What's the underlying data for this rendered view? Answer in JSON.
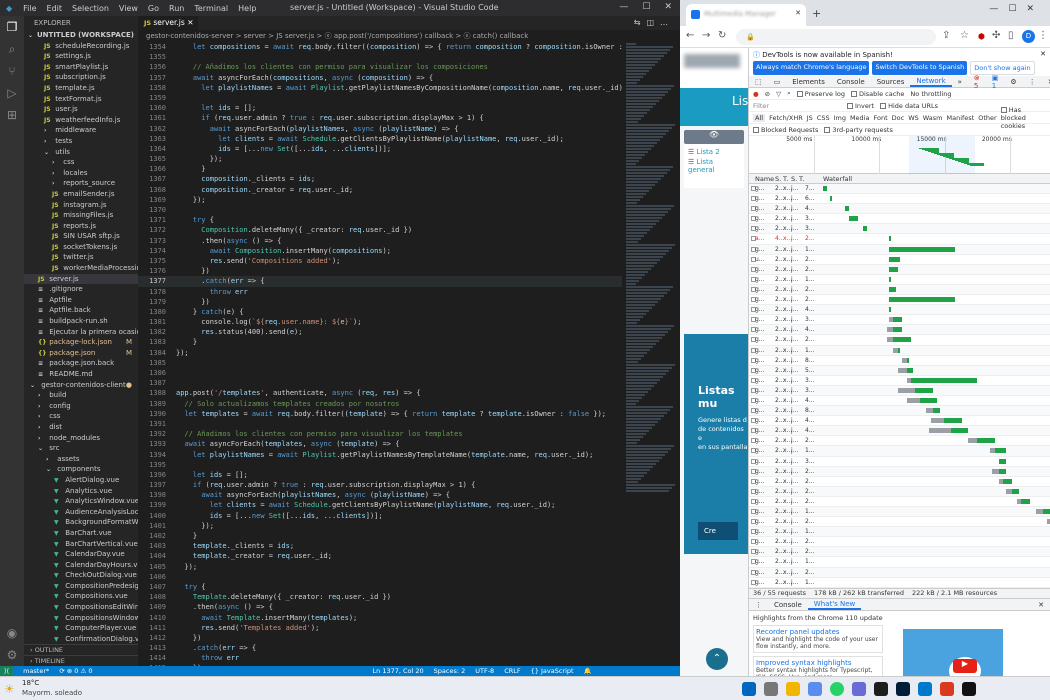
{
  "vscode": {
    "menu": [
      "File",
      "Edit",
      "Selection",
      "View",
      "Go",
      "Run",
      "Terminal",
      "Help"
    ],
    "window_title": "server.js - Untitled (Workspace) - Visual Studio Code",
    "tab_label": "server.js",
    "breadcrumb": "gestor-contenidos-server > server > JS server.js > ⓔ app.post('/compositions') callback > ⓔ catch() callback",
    "explorer_header": "EXPLORER",
    "workspace": "UNTITLED (WORKSPACE)",
    "tree": [
      {
        "label": "scheduleRecording.js",
        "type": "js"
      },
      {
        "label": "settings.js",
        "type": "js"
      },
      {
        "label": "smartPlaylist.js",
        "type": "js"
      },
      {
        "label": "subscription.js",
        "type": "js"
      },
      {
        "label": "template.js",
        "type": "js"
      },
      {
        "label": "textFormat.js",
        "type": "js"
      },
      {
        "label": "user.js",
        "type": "js"
      },
      {
        "label": "weatherfeedInfo.js",
        "type": "js"
      },
      {
        "label": "middleware",
        "type": "folder"
      },
      {
        "label": "tests",
        "type": "folder"
      },
      {
        "label": "utils",
        "type": "folder-open"
      },
      {
        "label": "css",
        "type": "folder"
      },
      {
        "label": "locales",
        "type": "folder"
      },
      {
        "label": "reports_source",
        "type": "folder"
      },
      {
        "label": "emailSender.js",
        "type": "js"
      },
      {
        "label": "instagram.js",
        "type": "js"
      },
      {
        "label": "missingFiles.js",
        "type": "js"
      },
      {
        "label": "reports.js",
        "type": "js"
      },
      {
        "label": "SIN USAR sftp.js",
        "type": "js"
      },
      {
        "label": "socketTokens.js",
        "type": "js"
      },
      {
        "label": "twitter.js",
        "type": "js"
      },
      {
        "label": "workerMediaProcessing.js",
        "type": "js"
      },
      {
        "label": "server.js",
        "type": "js",
        "selected": true
      },
      {
        "label": ".gitignore",
        "type": "file"
      },
      {
        "label": "Aptfile",
        "type": "file"
      },
      {
        "label": "Aptfile.back",
        "type": "file"
      },
      {
        "label": "buildpack-run.sh",
        "type": "file"
      },
      {
        "label": "Ejecutar la primera ocasión des...",
        "type": "file"
      },
      {
        "label": "package-lock.json",
        "type": "json",
        "badge": "M"
      },
      {
        "label": "package.json",
        "type": "json",
        "badge": "M"
      },
      {
        "label": "package.json.back",
        "type": "file"
      },
      {
        "label": "README.md",
        "type": "file"
      },
      {
        "label": "gestor-contenidos-client",
        "type": "folder-open",
        "badge": "●"
      },
      {
        "label": "build",
        "type": "folder"
      },
      {
        "label": "config",
        "type": "folder"
      },
      {
        "label": "css",
        "type": "folder"
      },
      {
        "label": "dist",
        "type": "folder"
      },
      {
        "label": "node_modules",
        "type": "folder"
      },
      {
        "label": "src",
        "type": "folder-open"
      },
      {
        "label": "assets",
        "type": "folder"
      },
      {
        "label": "components",
        "type": "folder-open"
      },
      {
        "label": "AlertDialog.vue",
        "type": "vue"
      },
      {
        "label": "Analytics.vue",
        "type": "vue"
      },
      {
        "label": "AnalyticsWindow.vue",
        "type": "vue"
      },
      {
        "label": "AudienceAnalysisLockedWi...",
        "type": "vue"
      },
      {
        "label": "BackgroundFormatWindow...",
        "type": "vue"
      },
      {
        "label": "BarChart.vue",
        "type": "vue"
      },
      {
        "label": "BarChartVertical.vue",
        "type": "vue"
      },
      {
        "label": "CalendarDay.vue",
        "type": "vue"
      },
      {
        "label": "CalendarDayHours.vue",
        "type": "vue"
      },
      {
        "label": "CheckOutDialog.vue",
        "type": "vue"
      },
      {
        "label": "CompositionPredesignDialo...",
        "type": "vue"
      },
      {
        "label": "Compositions.vue",
        "type": "vue"
      },
      {
        "label": "CompositionsEditWindow.vue",
        "type": "vue"
      },
      {
        "label": "CompositionsWindow.vue",
        "type": "vue"
      },
      {
        "label": "ComputerPlayer.vue",
        "type": "vue"
      },
      {
        "label": "ConfirmationDialog.vue",
        "type": "vue"
      }
    ],
    "outline_label": "OUTLINE",
    "timeline_label": "TIMELINE",
    "code": [
      {
        "n": "1354",
        "t": "    let compositions = await req.body.filter((composition) => { return composition ? composition.isOwner : false });"
      },
      {
        "n": "1355",
        "t": ""
      },
      {
        "n": "1356",
        "t": "    // Añadimos los clientes con permiso para visualizar los composiciones"
      },
      {
        "n": "1357",
        "t": "    await asyncForEach(compositions, async (composition) => {"
      },
      {
        "n": "1358",
        "t": "      let playlistNames = await Playlist.getPlaylistNamesByCompositionName(composition.name, req.user._id);"
      },
      {
        "n": "1359",
        "t": ""
      },
      {
        "n": "1360",
        "t": "      let ids = [];"
      },
      {
        "n": "1361",
        "t": "      if (req.user.admin ? true : req.user.subscription.displayMax > 1) {"
      },
      {
        "n": "1362",
        "t": "        await asyncForEach(playlistNames, async (playlistName) => {"
      },
      {
        "n": "1363",
        "t": "          let clients = await Schedule.getClientsByPlaylistName(playlistName, req.user._id);"
      },
      {
        "n": "1364",
        "t": "          ids = [...new Set([...ids, ...clients])];"
      },
      {
        "n": "1365",
        "t": "        });"
      },
      {
        "n": "1366",
        "t": "      }"
      },
      {
        "n": "1367",
        "t": "      composition._clients = ids;"
      },
      {
        "n": "1368",
        "t": "      composition._creator = req.user._id;"
      },
      {
        "n": "1369",
        "t": "    });"
      },
      {
        "n": "1370",
        "t": ""
      },
      {
        "n": "1371",
        "t": "    try {"
      },
      {
        "n": "1372",
        "t": "      Composition.deleteMany({ _creator: req.user._id })"
      },
      {
        "n": "1373",
        "t": "      .then(async () => {"
      },
      {
        "n": "1374",
        "t": "        await Composition.insertMany(compositions);"
      },
      {
        "n": "1375",
        "t": "        res.send('Compositions added');"
      },
      {
        "n": "1376",
        "t": "      })"
      },
      {
        "n": "1377",
        "t": "      .catch(err => {",
        "cur": true
      },
      {
        "n": "1378",
        "t": "        throw err"
      },
      {
        "n": "1379",
        "t": "      })"
      },
      {
        "n": "1380",
        "t": "    } catch(e) {"
      },
      {
        "n": "1381",
        "t": "      console.log(`${req.user.name}: ${e}`);"
      },
      {
        "n": "1382",
        "t": "      res.status(400).send(e);"
      },
      {
        "n": "1383",
        "t": "    }"
      },
      {
        "n": "1384",
        "t": "});"
      },
      {
        "n": "1385",
        "t": ""
      },
      {
        "n": "1386",
        "t": ""
      },
      {
        "n": "1387",
        "t": ""
      },
      {
        "n": "1388",
        "t": "app.post('/templates', authenticate, async (req, res) => {"
      },
      {
        "n": "1389",
        "t": "  // Solo actualizamos templates creados por nosotros"
      },
      {
        "n": "1390",
        "t": "  let templates = await req.body.filter((template) => { return template ? template.isOwner : false });"
      },
      {
        "n": "1391",
        "t": ""
      },
      {
        "n": "1392",
        "t": "  // Añadimos los clientes con permiso para visualizar los templates"
      },
      {
        "n": "1393",
        "t": "  await asyncForEach(templates, async (template) => {"
      },
      {
        "n": "1394",
        "t": "    let playlistNames = await Playlist.getPlaylistNamesByTemplateName(template.name, req.user._id);"
      },
      {
        "n": "1395",
        "t": ""
      },
      {
        "n": "1396",
        "t": "    let ids = [];"
      },
      {
        "n": "1397",
        "t": "    if (req.user.admin ? true : req.user.subscription.displayMax > 1) {"
      },
      {
        "n": "1398",
        "t": "      await asyncForEach(playlistNames, async (playlistName) => {"
      },
      {
        "n": "1399",
        "t": "        let clients = await Schedule.getClientsByPlaylistName(playlistName, req.user._id);"
      },
      {
        "n": "1400",
        "t": "        ids = [...new Set([...ids, ...clients])];"
      },
      {
        "n": "1401",
        "t": "      });"
      },
      {
        "n": "1402",
        "t": "    }"
      },
      {
        "n": "1403",
        "t": "    template._clients = ids;"
      },
      {
        "n": "1404",
        "t": "    template._creator = req.user._id;"
      },
      {
        "n": "1405",
        "t": "  });"
      },
      {
        "n": "1406",
        "t": ""
      },
      {
        "n": "1407",
        "t": "  try {"
      },
      {
        "n": "1408",
        "t": "    Template.deleteMany({ _creator: req.user._id })"
      },
      {
        "n": "1409",
        "t": "    .then(async () => {"
      },
      {
        "n": "1410",
        "t": "      await Template.insertMany(templates);"
      },
      {
        "n": "1411",
        "t": "      res.send('Templates added');"
      },
      {
        "n": "1412",
        "t": "    })"
      },
      {
        "n": "1413",
        "t": "    .catch(err => {"
      },
      {
        "n": "1414",
        "t": "      throw err"
      },
      {
        "n": "1415",
        "t": "    })"
      },
      {
        "n": "1416",
        "t": "  } catch(e) {"
      },
      {
        "n": "1417",
        "t": "    console.log(`${req.user.name}: ${e}`);"
      },
      {
        "n": "1418",
        "t": "    res.status(400).send(e);"
      },
      {
        "n": "1419",
        "t": "  }"
      },
      {
        "n": "1420",
        "t": "});"
      }
    ],
    "status": {
      "branch": "master*",
      "sync": "⟳ ⊗ 0 ⚠ 0",
      "position": "Ln 1377, Col 20",
      "spaces": "Spaces: 2",
      "encoding": "UTF-8",
      "eol": "CRLF",
      "language": "{} JavaScript"
    }
  },
  "chrome": {
    "tab_title": "Multimedia Manager",
    "url": "",
    "page_heading": "Lista",
    "page_items": [
      "Lista 2",
      "Lista general"
    ],
    "page_banner_title": "Listas mu",
    "page_banner_text": [
      "Genere listas d",
      "de contenidos e",
      "en sus pantalla"
    ],
    "page_button": "Cre",
    "devtools": {
      "notice": "DevTools is now available in Spanish!",
      "btn_match": "Always match Chrome's language",
      "btn_switch": "Switch DevTools to Spanish",
      "btn_dismiss": "Don't show again",
      "tabs": [
        "Elements",
        "Console",
        "Sources",
        "Network",
        "»"
      ],
      "active_tab": "Network",
      "errors": "5",
      "warnings": "1",
      "preserve_log": "Preserve log",
      "disable_cache": "Disable cache",
      "throttle": "No throttling",
      "filter_placeholder": "Filter",
      "invert": "Invert",
      "hide_data": "Hide data URLs",
      "types": [
        "All",
        "Fetch/XHR",
        "JS",
        "CSS",
        "Img",
        "Media",
        "Font",
        "Doc",
        "WS",
        "Wasm",
        "Manifest",
        "Other"
      ],
      "blocked_cookies": "Has blocked cookies",
      "blocked_requests": "Blocked Requests",
      "third_party": "3rd-party requests",
      "timeline_ticks": [
        "5000 ms",
        "10000 ms",
        "15000 ms",
        "20000 ms"
      ],
      "columns": [
        "Name",
        "S.",
        "T.",
        "S.",
        "T.",
        "Waterfall"
      ],
      "requests": [
        {
          "name": "g...",
          "s": "2...",
          "t": "x...",
          "size": "j...",
          "time": "7..."
        },
        {
          "name": "g...",
          "s": "2...",
          "t": "x...",
          "size": "j...",
          "time": "6..."
        },
        {
          "name": "g...",
          "s": "2...",
          "t": "x...",
          "size": "j...",
          "time": "4..."
        },
        {
          "name": "g...",
          "s": "2...",
          "t": "x...",
          "size": "j...",
          "time": "3..."
        },
        {
          "name": "g...",
          "s": "2...",
          "t": "x...",
          "size": "j...",
          "time": "3..."
        },
        {
          "name": "a...",
          "s": "4...",
          "t": "x...",
          "size": "j...",
          "time": "2...",
          "red": true
        },
        {
          "name": "g...",
          "s": "2...",
          "t": "x...",
          "size": "j...",
          "time": "1..."
        },
        {
          "name": "u...",
          "s": "2...",
          "t": "x...",
          "size": "j...",
          "time": "2..."
        },
        {
          "name": "g...",
          "s": "2...",
          "t": "x...",
          "size": "j...",
          "time": "2..."
        },
        {
          "name": "g...",
          "s": "2...",
          "t": "x...",
          "size": "j...",
          "time": "1..."
        },
        {
          "name": "g...",
          "s": "2...",
          "t": "x...",
          "size": "j...",
          "time": "2..."
        },
        {
          "name": "g...",
          "s": "2...",
          "t": "x...",
          "size": "j...",
          "time": "2..."
        },
        {
          "name": "g...",
          "s": "2...",
          "t": "x...",
          "size": "j...",
          "time": "4..."
        },
        {
          "name": "g...",
          "s": "2...",
          "t": "x...",
          "size": "j...",
          "time": "3..."
        },
        {
          "name": "g...",
          "s": "2...",
          "t": "x...",
          "size": "j...",
          "time": "4..."
        },
        {
          "name": "g...",
          "s": "2...",
          "t": "x...",
          "size": "j...",
          "time": "2..."
        },
        {
          "name": "g...",
          "s": "2...",
          "t": "x...",
          "size": "j...",
          "time": "1..."
        },
        {
          "name": "g...",
          "s": "2...",
          "t": "x...",
          "size": "j...",
          "time": "8..."
        },
        {
          "name": "g...",
          "s": "2...",
          "t": "x...",
          "size": "j...",
          "time": "5..."
        },
        {
          "name": "g...",
          "s": "2...",
          "t": "x...",
          "size": "j...",
          "time": "3..."
        },
        {
          "name": "g...",
          "s": "2...",
          "t": "x...",
          "size": "j...",
          "time": "3..."
        },
        {
          "name": "g...",
          "s": "2...",
          "t": "x...",
          "size": "j...",
          "time": "4..."
        },
        {
          "name": "g...",
          "s": "2...",
          "t": "x...",
          "size": "j...",
          "time": "8..."
        },
        {
          "name": "g...",
          "s": "2...",
          "t": "x...",
          "size": "j...",
          "time": "4..."
        },
        {
          "name": "g...",
          "s": "2...",
          "t": "x...",
          "size": "j...",
          "time": "4..."
        },
        {
          "name": "g...",
          "s": "2...",
          "t": "x...",
          "size": "j...",
          "time": "2..."
        },
        {
          "name": "g...",
          "s": "2...",
          "t": "x...",
          "size": "j...",
          "time": "1..."
        },
        {
          "name": "g...",
          "s": "2...",
          "t": "x...",
          "size": "j...",
          "time": "3..."
        },
        {
          "name": "g...",
          "s": "2...",
          "t": "x...",
          "size": "j...",
          "time": "2..."
        },
        {
          "name": "g...",
          "s": "2...",
          "t": "x...",
          "size": "j...",
          "time": "2..."
        },
        {
          "name": "g...",
          "s": "2...",
          "t": "x...",
          "size": "j...",
          "time": "2..."
        },
        {
          "name": "g...",
          "s": "2...",
          "t": "x...",
          "size": "j...",
          "time": "2..."
        },
        {
          "name": "g...",
          "s": "2...",
          "t": "x...",
          "size": "j...",
          "time": "1..."
        },
        {
          "name": "g...",
          "s": "2...",
          "t": "x...",
          "size": "j...",
          "time": "2..."
        },
        {
          "name": "g...",
          "s": "2...",
          "t": "x...",
          "size": "j...",
          "time": "1..."
        },
        {
          "name": "g...",
          "s": "2...",
          "t": "x...",
          "size": "j...",
          "time": "2..."
        },
        {
          "name": "g...",
          "s": "2...",
          "t": "x...",
          "size": "j...",
          "time": "2..."
        },
        {
          "name": "g...",
          "s": "2...",
          "t": "x...",
          "size": "j...",
          "time": "1..."
        },
        {
          "name": "g...",
          "s": "2...",
          "t": "x...",
          "size": "j...",
          "time": "2..."
        },
        {
          "name": "g...",
          "s": "2...",
          "t": "x...",
          "size": "j...",
          "time": "1..."
        }
      ],
      "footer": [
        "36 / 55 requests",
        "178 kB / 262 kB transferred",
        "222 kB / 2.1 MB resources"
      ],
      "drawer_tabs": [
        "Console",
        "What's New"
      ],
      "drawer_active": "What's New",
      "highlights": "Highlights from the Chrome 110 update",
      "news": [
        {
          "title": "Recorder panel updates",
          "body": "View and highlight the code of your user flow instantly, and more."
        },
        {
          "title": "Improved syntax highlights",
          "body": "Better syntax highlights for Typescript, JSX, SCSS, Vue, and more."
        }
      ],
      "video_word": "new"
    }
  },
  "taskbar": {
    "temp": "18°C",
    "weather": "Mayorm. soleado"
  },
  "colors": {
    "accent": "#007acc",
    "chrome_blue": "#1a73e8",
    "net_green": "#1ea446"
  }
}
